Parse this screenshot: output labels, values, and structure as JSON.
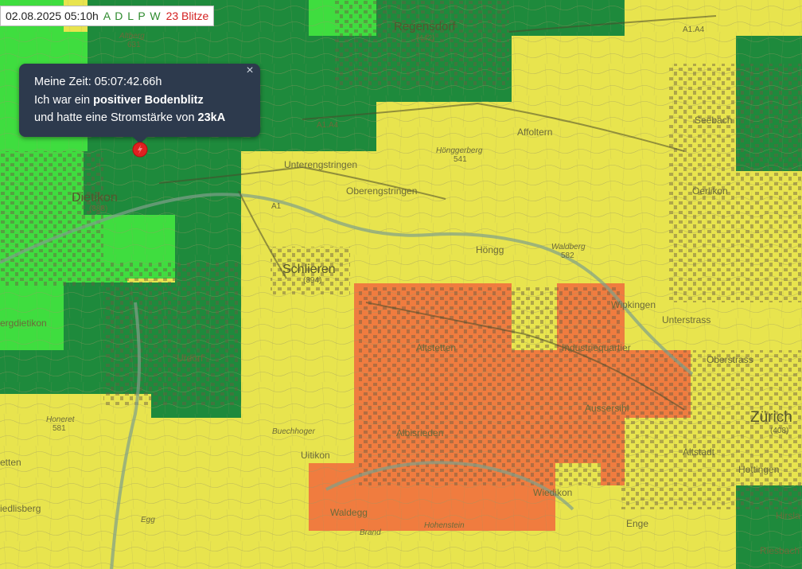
{
  "status_bar": {
    "datetime": "02.08.2025 05:10h",
    "layers": "A D L P W",
    "strike_count": "23 Blitze"
  },
  "popup": {
    "line1": "Meine Zeit: 05:07:42.66h",
    "line2_prefix": "Ich war ein ",
    "line2_bold": "positiver Bodenblitz",
    "line3_prefix": "und hatte eine Stromstärke von ",
    "line3_bold": "23kA",
    "close_symbol": "×"
  },
  "map": {
    "places": {
      "regensdorf": "Regensdorf",
      "regensdorf_elev": "(442)",
      "altberg": "Altberg",
      "altberg_elev": "631",
      "dietikon": "Dietikon",
      "dietikon_elev": "(388)",
      "unterengstringen": "Unterengstringen",
      "oberengstringen": "Oberengstringen",
      "affoltern": "Affoltern",
      "honggerberg": "Hönggerberg",
      "honggerberg_elev": "541",
      "seebach": "Seebach",
      "oerlikon": "Oerlikon",
      "hongg": "Höngg",
      "waldberg": "Waldberg",
      "waldberg_elev": "582",
      "schlieren": "Schlieren",
      "schlieren_elev": "(394)",
      "wipkingen": "Wipkingen",
      "unterstrass": "Unterstrass",
      "bergdietikon": "ergdietikon",
      "altstetten": "Altstetten",
      "industriequartier": "Industriequartier",
      "oberstrass": "Oberstrass",
      "urdorf": "Urdorf",
      "aussersihl": "Aussersihl",
      "honeret": "Honeret",
      "honeret_elev": "581",
      "buechhoger": "Buechhoger",
      "albisrieden": "Albisrieden",
      "zurich": "Zürich",
      "zurich_elev": "(408)",
      "uitikon": "Uitikon",
      "altstadt": "Altstadt",
      "hottingen": "Hottingen",
      "stetten": "etten",
      "riedlisberg": "iedlisberg",
      "waldegg": "Waldegg",
      "wiedikon": "Wiedikon",
      "hohenstein": "Hohenstein",
      "egg": "Egg",
      "enge": "Enge",
      "hirsla": "Hirsla",
      "riesbach": "Riesbach",
      "brand": "Brand",
      "a1": "A1",
      "a1a4": "A1.A4",
      "a1a4_east": "A1.A4"
    }
  },
  "colors": {
    "yellow": "#e8e44e",
    "light_green": "#3fdd3f",
    "dark_green": "#1e8a3c",
    "orange": "#f07c3f",
    "marker": "#e02020"
  }
}
